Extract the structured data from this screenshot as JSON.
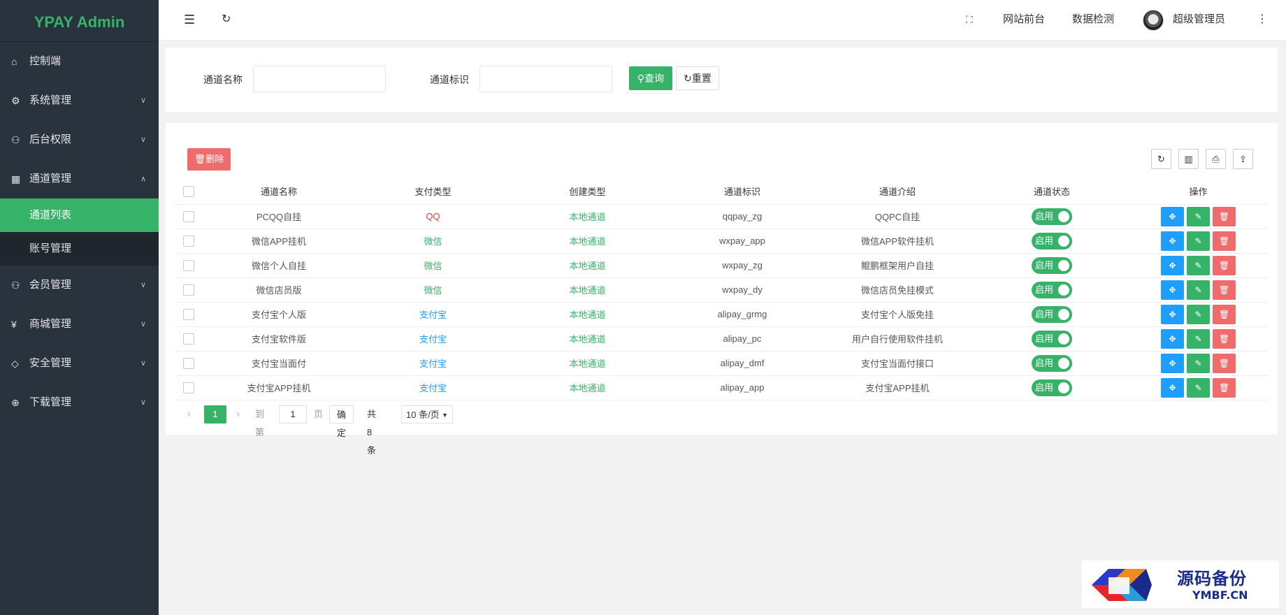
{
  "app": {
    "title": "YPAY Admin"
  },
  "sidebar": {
    "items": [
      {
        "label": "控制端",
        "icon": "home-icon"
      },
      {
        "label": "系统管理",
        "icon": "gear-icon"
      },
      {
        "label": "后台权限",
        "icon": "user-icon"
      },
      {
        "label": "通道管理",
        "icon": "apps-icon"
      },
      {
        "label": "会员管理",
        "icon": "user-icon"
      },
      {
        "label": "商城管理",
        "icon": "yen-icon"
      },
      {
        "label": "安全管理",
        "icon": "diamond-icon"
      },
      {
        "label": "下载管理",
        "icon": "download-icon"
      }
    ],
    "sub_items": [
      {
        "label": "通道列表"
      },
      {
        "label": "账号管理"
      }
    ]
  },
  "header": {
    "menu_icon": "menu-fold-icon",
    "refresh_icon": "refresh-icon",
    "fullscreen_icon": "fullscreen-icon",
    "site_front": "网站前台",
    "data_check": "数据检测",
    "user_name": "超级管理员",
    "more_icon": "more-vertical-icon"
  },
  "search": {
    "name_label": "通道名称",
    "name_value": "",
    "ident_label": "通道标识",
    "ident_value": "",
    "query_button": "查询",
    "reset_button": "重置"
  },
  "toolbar": {
    "delete_button": "删除"
  },
  "table": {
    "columns": [
      "通道名称",
      "支付类型",
      "创建类型",
      "通道标识",
      "通道介绍",
      "通道状态",
      "操作"
    ],
    "rows": [
      {
        "name": "PCQQ自挂",
        "pay_type": "QQ",
        "pay_color": "red",
        "create_type": "本地通道",
        "ident": "qqpay_zg",
        "intro": "QQPC自挂",
        "status": "启用"
      },
      {
        "name": "微信APP挂机",
        "pay_type": "微信",
        "pay_color": "green",
        "create_type": "本地通道",
        "ident": "wxpay_app",
        "intro": "微信APP软件挂机",
        "status": "启用"
      },
      {
        "name": "微信个人自挂",
        "pay_type": "微信",
        "pay_color": "green",
        "create_type": "本地通道",
        "ident": "wxpay_zg",
        "intro": "鲲鹏框架用户自挂",
        "status": "启用"
      },
      {
        "name": "微信店员版",
        "pay_type": "微信",
        "pay_color": "green",
        "create_type": "本地通道",
        "ident": "wxpay_dy",
        "intro": "微信店员免挂模式",
        "status": "启用"
      },
      {
        "name": "支付宝个人版",
        "pay_type": "支付宝",
        "pay_color": "blue",
        "create_type": "本地通道",
        "ident": "alipay_grmg",
        "intro": "支付宝个人版免挂",
        "status": "启用"
      },
      {
        "name": "支付宝软件版",
        "pay_type": "支付宝",
        "pay_color": "blue",
        "create_type": "本地通道",
        "ident": "alipay_pc",
        "intro": "用户自行使用软件挂机",
        "status": "启用"
      },
      {
        "name": "支付宝当面付",
        "pay_type": "支付宝",
        "pay_color": "blue",
        "create_type": "本地通道",
        "ident": "alipay_dmf",
        "intro": "支付宝当面付接口",
        "status": "启用"
      },
      {
        "name": "支付宝APP挂机",
        "pay_type": "支付宝",
        "pay_color": "blue",
        "create_type": "本地通道",
        "ident": "alipay_app",
        "intro": "支付宝APP挂机",
        "status": "启用"
      }
    ]
  },
  "pager": {
    "current_page": "1",
    "goto_label": "到第",
    "goto_value": "1",
    "page_unit": "页",
    "confirm": "确定",
    "total": "共 8 条",
    "page_size": "10 条/页"
  },
  "watermark": {
    "title": "源码备份",
    "domain": "YMBF.CN"
  },
  "colors": {
    "brand": "#36b368",
    "danger": "#f06b6b",
    "info": "#1e9fff",
    "sidebar_bg": "#28333e"
  }
}
